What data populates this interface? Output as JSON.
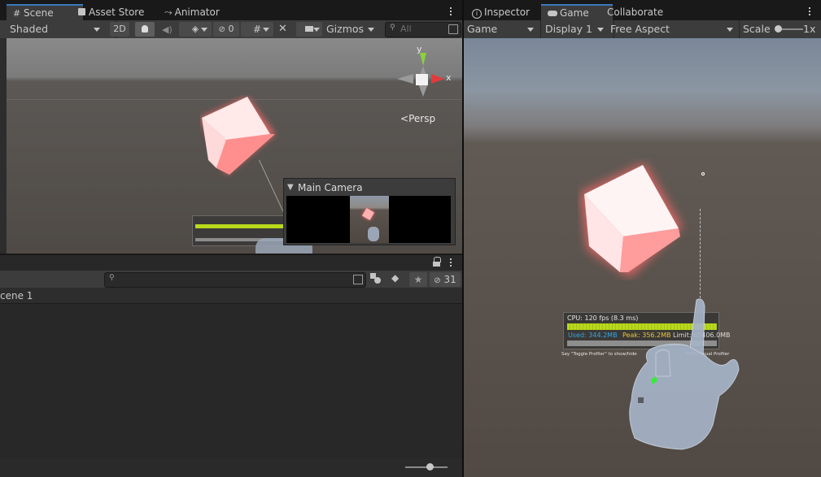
{
  "scene_window": {
    "tabs": [
      {
        "label": "Scene",
        "icon": "grid-icon"
      },
      {
        "label": "Asset Store",
        "icon": "bag-icon"
      },
      {
        "label": "Animator",
        "icon": "animator-icon"
      }
    ],
    "toolbar": {
      "shading_mode": "Shaded",
      "mode_2d": "2D",
      "hidden_count": "0",
      "gizmos_label": "Gizmos",
      "search_placeholder": "All"
    },
    "gizmo": {
      "y_label": "y",
      "x_label": "x",
      "projection": "Persp"
    },
    "camera_preview": {
      "title": "Main Camera"
    }
  },
  "hierarchy": {
    "search_placeholder": "",
    "visible_count": "31",
    "scene_item": "cene 1"
  },
  "game_window": {
    "tabs": [
      {
        "label": "Inspector",
        "icon": "info-icon"
      },
      {
        "label": "Game",
        "icon": "gamepad-icon"
      },
      {
        "label": "Collaborate",
        "icon": ""
      }
    ],
    "toolbar": {
      "target": "Game",
      "display": "Display 1",
      "aspect": "Free Aspect",
      "scale_label": "Scale",
      "scale_value": "1x"
    },
    "profiler": {
      "cpu": "CPU: 120 fps (8.3 ms)",
      "used": "Used: 344.2MB",
      "peak": "Peak: 356.2MB",
      "limit": "Limit: 65406.0MB",
      "footer_left": "Say \"Toggle Profiler\" to show/hide",
      "footer_right": "MRTK Visual Profiler"
    }
  },
  "colors": {
    "accent": "#3a79bb",
    "panel": "#3c3c3c",
    "background": "#191919",
    "cpu_bar": "#b8d91c",
    "used_text": "#2fa8e8",
    "peak_text": "#e8c43a"
  }
}
